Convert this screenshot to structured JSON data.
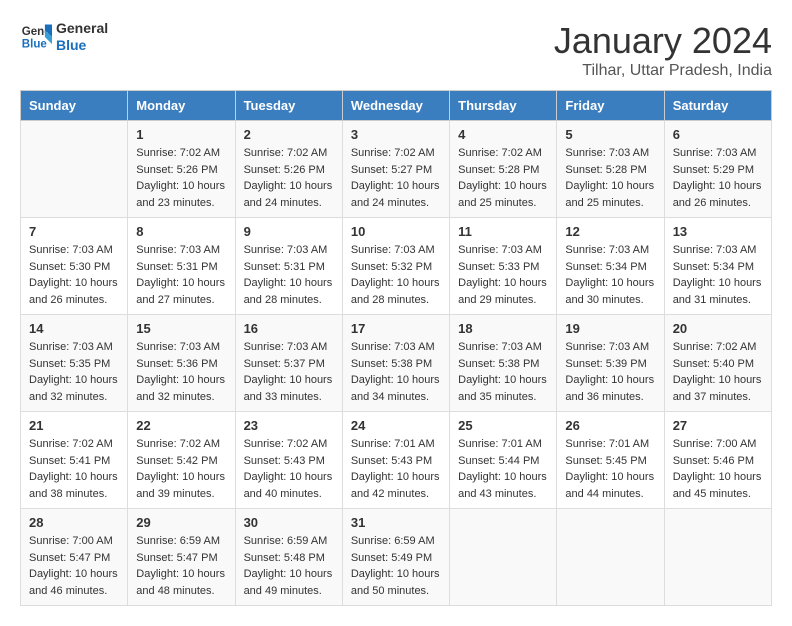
{
  "header": {
    "logo_general": "General",
    "logo_blue": "Blue",
    "title": "January 2024",
    "subtitle": "Tilhar, Uttar Pradesh, India"
  },
  "days_of_week": [
    "Sunday",
    "Monday",
    "Tuesday",
    "Wednesday",
    "Thursday",
    "Friday",
    "Saturday"
  ],
  "weeks": [
    [
      {
        "day": "",
        "info": ""
      },
      {
        "day": "1",
        "info": "Sunrise: 7:02 AM\nSunset: 5:26 PM\nDaylight: 10 hours\nand 23 minutes."
      },
      {
        "day": "2",
        "info": "Sunrise: 7:02 AM\nSunset: 5:26 PM\nDaylight: 10 hours\nand 24 minutes."
      },
      {
        "day": "3",
        "info": "Sunrise: 7:02 AM\nSunset: 5:27 PM\nDaylight: 10 hours\nand 24 minutes."
      },
      {
        "day": "4",
        "info": "Sunrise: 7:02 AM\nSunset: 5:28 PM\nDaylight: 10 hours\nand 25 minutes."
      },
      {
        "day": "5",
        "info": "Sunrise: 7:03 AM\nSunset: 5:28 PM\nDaylight: 10 hours\nand 25 minutes."
      },
      {
        "day": "6",
        "info": "Sunrise: 7:03 AM\nSunset: 5:29 PM\nDaylight: 10 hours\nand 26 minutes."
      }
    ],
    [
      {
        "day": "7",
        "info": "Sunrise: 7:03 AM\nSunset: 5:30 PM\nDaylight: 10 hours\nand 26 minutes."
      },
      {
        "day": "8",
        "info": "Sunrise: 7:03 AM\nSunset: 5:31 PM\nDaylight: 10 hours\nand 27 minutes."
      },
      {
        "day": "9",
        "info": "Sunrise: 7:03 AM\nSunset: 5:31 PM\nDaylight: 10 hours\nand 28 minutes."
      },
      {
        "day": "10",
        "info": "Sunrise: 7:03 AM\nSunset: 5:32 PM\nDaylight: 10 hours\nand 28 minutes."
      },
      {
        "day": "11",
        "info": "Sunrise: 7:03 AM\nSunset: 5:33 PM\nDaylight: 10 hours\nand 29 minutes."
      },
      {
        "day": "12",
        "info": "Sunrise: 7:03 AM\nSunset: 5:34 PM\nDaylight: 10 hours\nand 30 minutes."
      },
      {
        "day": "13",
        "info": "Sunrise: 7:03 AM\nSunset: 5:34 PM\nDaylight: 10 hours\nand 31 minutes."
      }
    ],
    [
      {
        "day": "14",
        "info": "Sunrise: 7:03 AM\nSunset: 5:35 PM\nDaylight: 10 hours\nand 32 minutes."
      },
      {
        "day": "15",
        "info": "Sunrise: 7:03 AM\nSunset: 5:36 PM\nDaylight: 10 hours\nand 32 minutes."
      },
      {
        "day": "16",
        "info": "Sunrise: 7:03 AM\nSunset: 5:37 PM\nDaylight: 10 hours\nand 33 minutes."
      },
      {
        "day": "17",
        "info": "Sunrise: 7:03 AM\nSunset: 5:38 PM\nDaylight: 10 hours\nand 34 minutes."
      },
      {
        "day": "18",
        "info": "Sunrise: 7:03 AM\nSunset: 5:38 PM\nDaylight: 10 hours\nand 35 minutes."
      },
      {
        "day": "19",
        "info": "Sunrise: 7:03 AM\nSunset: 5:39 PM\nDaylight: 10 hours\nand 36 minutes."
      },
      {
        "day": "20",
        "info": "Sunrise: 7:02 AM\nSunset: 5:40 PM\nDaylight: 10 hours\nand 37 minutes."
      }
    ],
    [
      {
        "day": "21",
        "info": "Sunrise: 7:02 AM\nSunset: 5:41 PM\nDaylight: 10 hours\nand 38 minutes."
      },
      {
        "day": "22",
        "info": "Sunrise: 7:02 AM\nSunset: 5:42 PM\nDaylight: 10 hours\nand 39 minutes."
      },
      {
        "day": "23",
        "info": "Sunrise: 7:02 AM\nSunset: 5:43 PM\nDaylight: 10 hours\nand 40 minutes."
      },
      {
        "day": "24",
        "info": "Sunrise: 7:01 AM\nSunset: 5:43 PM\nDaylight: 10 hours\nand 42 minutes."
      },
      {
        "day": "25",
        "info": "Sunrise: 7:01 AM\nSunset: 5:44 PM\nDaylight: 10 hours\nand 43 minutes."
      },
      {
        "day": "26",
        "info": "Sunrise: 7:01 AM\nSunset: 5:45 PM\nDaylight: 10 hours\nand 44 minutes."
      },
      {
        "day": "27",
        "info": "Sunrise: 7:00 AM\nSunset: 5:46 PM\nDaylight: 10 hours\nand 45 minutes."
      }
    ],
    [
      {
        "day": "28",
        "info": "Sunrise: 7:00 AM\nSunset: 5:47 PM\nDaylight: 10 hours\nand 46 minutes."
      },
      {
        "day": "29",
        "info": "Sunrise: 6:59 AM\nSunset: 5:47 PM\nDaylight: 10 hours\nand 48 minutes."
      },
      {
        "day": "30",
        "info": "Sunrise: 6:59 AM\nSunset: 5:48 PM\nDaylight: 10 hours\nand 49 minutes."
      },
      {
        "day": "31",
        "info": "Sunrise: 6:59 AM\nSunset: 5:49 PM\nDaylight: 10 hours\nand 50 minutes."
      },
      {
        "day": "",
        "info": ""
      },
      {
        "day": "",
        "info": ""
      },
      {
        "day": "",
        "info": ""
      }
    ]
  ]
}
